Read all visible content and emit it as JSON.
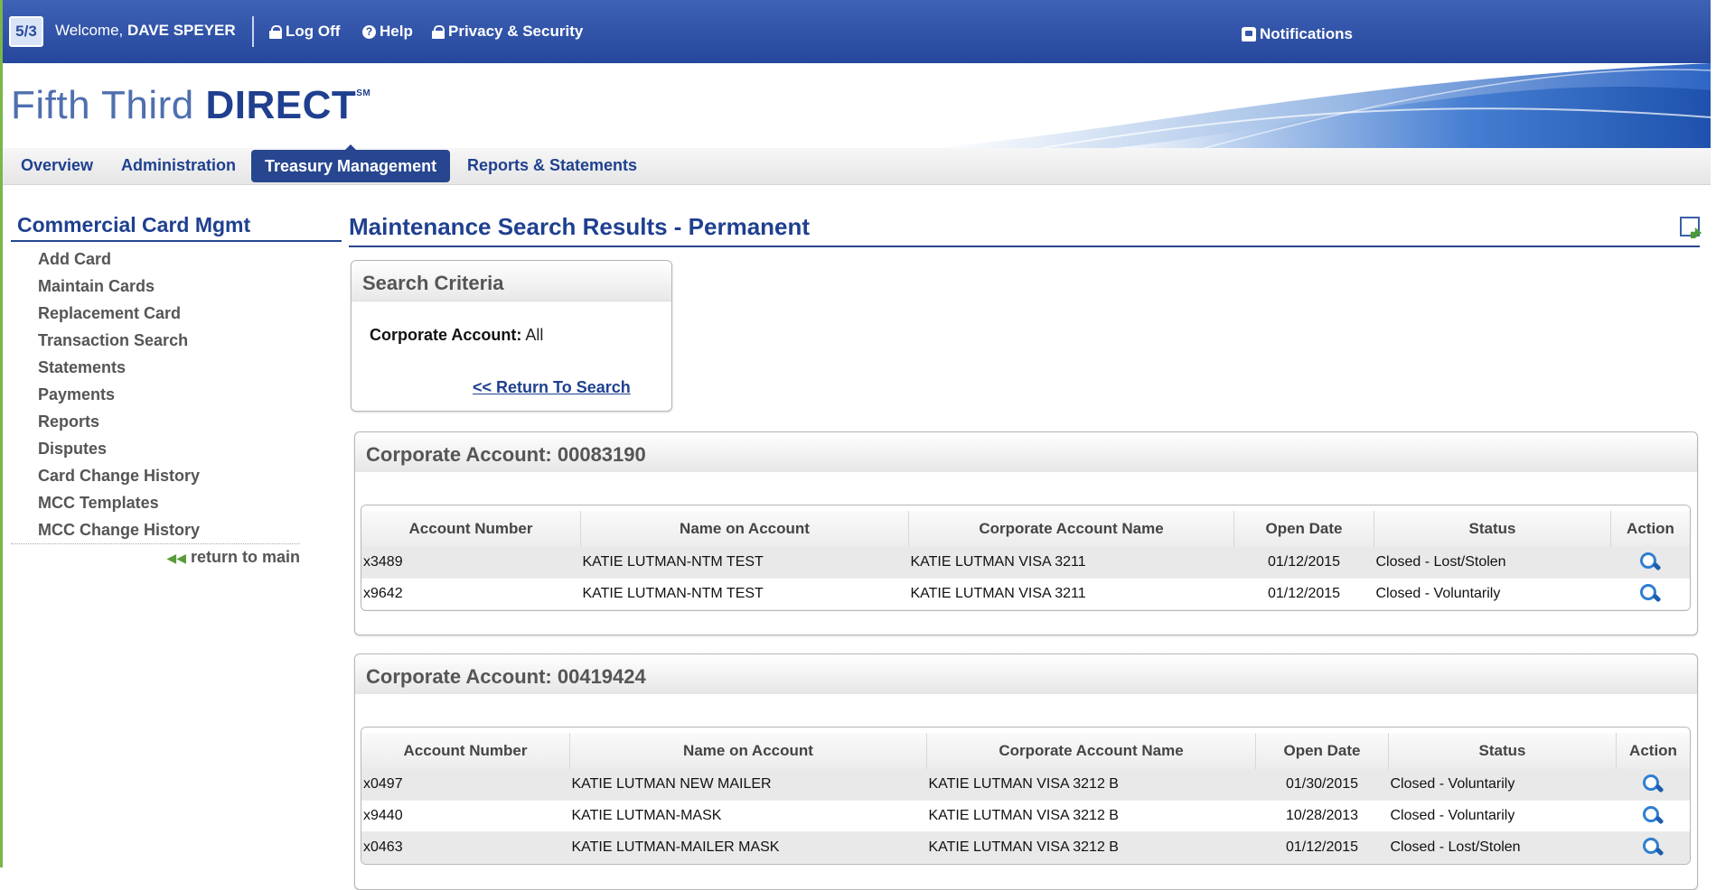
{
  "topbar": {
    "welcome_prefix": "Welcome,",
    "user_name": "DAVE SPEYER",
    "logoff": "Log Off",
    "help": "Help",
    "privacy": "Privacy & Security",
    "notifications": "Notifications"
  },
  "brand": {
    "thin": "Fifth Third",
    "bold": "DIRECT",
    "mark": "SM"
  },
  "nav": {
    "items": [
      "Overview",
      "Administration",
      "Treasury Management",
      "Reports & Statements"
    ],
    "active": "Treasury Management"
  },
  "sidebar": {
    "title": "Commercial Card Mgmt",
    "items": [
      "Add Card",
      "Maintain Cards",
      "Replacement Card",
      "Transaction Search",
      "Statements",
      "Payments",
      "Reports",
      "Disputes",
      "Card Change History",
      "MCC Templates",
      "MCC Change History"
    ],
    "return_label": "return to main"
  },
  "main": {
    "title": "Maintenance Search Results - Permanent",
    "criteria": {
      "header": "Search Criteria",
      "field_label": "Corporate Account:",
      "field_value": "All",
      "return_arrows": "<<",
      "return_label": "Return To Search"
    },
    "columns": [
      "Account Number",
      "Name on Account",
      "Corporate Account Name",
      "Open Date",
      "Status",
      "Action"
    ],
    "accounts": [
      {
        "header": "Corporate Account: 00083190",
        "rows": [
          {
            "acct": "x3489",
            "name": "KATIE LUTMAN-NTM TEST",
            "corp": "KATIE LUTMAN VISA 3211",
            "date": "01/12/2015",
            "status": "Closed - Lost/Stolen"
          },
          {
            "acct": "x9642",
            "name": "KATIE LUTMAN-NTM TEST",
            "corp": "KATIE LUTMAN VISA 3211",
            "date": "01/12/2015",
            "status": "Closed - Voluntarily"
          }
        ]
      },
      {
        "header": "Corporate Account: 00419424",
        "rows": [
          {
            "acct": "x0497",
            "name": "KATIE LUTMAN NEW MAILER",
            "corp": "KATIE LUTMAN VISA 3212 B",
            "date": "01/30/2015",
            "status": "Closed - Voluntarily"
          },
          {
            "acct": "x9440",
            "name": "KATIE LUTMAN-MASK",
            "corp": "KATIE LUTMAN VISA 3212 B",
            "date": "10/28/2013",
            "status": "Closed - Voluntarily"
          },
          {
            "acct": "x0463",
            "name": "KATIE LUTMAN-MAILER MASK",
            "corp": "KATIE LUTMAN VISA 3212 B",
            "date": "01/12/2015",
            "status": "Closed - Lost/Stolen"
          }
        ]
      }
    ]
  }
}
